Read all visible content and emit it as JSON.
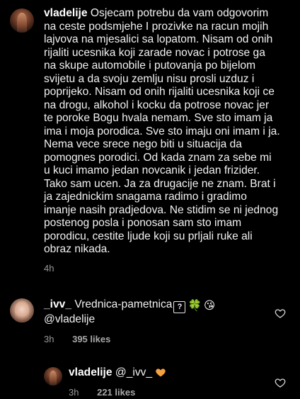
{
  "post": {
    "username": "vladelije",
    "lines": [
      "Osjecam potrebu da vam odgovorim",
      "na ceste podsmjehe I prozivke na racun mojih",
      "lajvova na mjesalici sa lopatom. Nisam od onih",
      "rijaliti ucesnika koji zarade novac i potrose ga",
      "na skupe automobile i putovanja po bijelom",
      "svijetu a da svoju zemlju nisu prosli uzduz i",
      "poprijeko. Nisam od onih rijaliti ucesnika koji ce",
      "na drogu, alkohol i kocku da potrose novac jer",
      "te poroke Bogu hvala nemam. Sve sto imam ja",
      "ima i moja porodica. Sve sto imaju oni imam i ja.",
      "Nema vece srece nego biti u situacija da",
      "pomognes porodici. Od kada znam za sebe mi",
      "u kuci imamo jedan novcanik i jedan frizider.",
      "Tako sam ucen. Ja za drugacije ne znam. Brat i",
      "ja zajednickim snagama radimo i gradimo",
      "imanje nasih pradjedova. Ne stidim se ni jednog",
      "postenog posla i ponosan sam sto imam",
      "porodicu, cestite ljude koji su prljali ruke ali",
      "obraz nikada."
    ],
    "time": "4h"
  },
  "comment": {
    "username": "_ivv_",
    "text": "Vrednica-pametnica",
    "qmark": "?",
    "emoji_clover": "🍀",
    "emoji_face": "😘",
    "mention": "@vladelije",
    "time": "3h",
    "likes": "395 likes"
  },
  "reply": {
    "username": "vladelije",
    "mention": "@_ivv_",
    "time": "3h",
    "likes": "221 likes"
  },
  "colors": {
    "background": "#000000",
    "text": "#f2f2f2",
    "meta": "#9a9a9a",
    "heart_orange": "#f5a142"
  }
}
